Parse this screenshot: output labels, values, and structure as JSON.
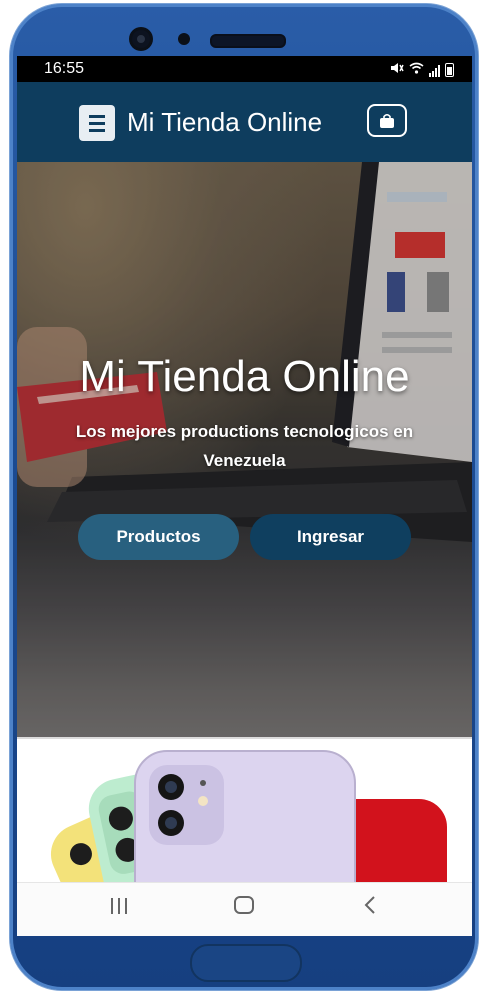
{
  "status_bar": {
    "time": "16:55",
    "icons": [
      "mute-icon",
      "wifi-icon",
      "signal-icon",
      "battery-icon"
    ]
  },
  "app_bar": {
    "title": "Mi Tienda Online",
    "menu_icon": "hamburger-menu-icon",
    "cart_icon": "shopping-bag-icon",
    "background": "#0e3d5e"
  },
  "hero": {
    "title": "Mi Tienda Online",
    "subtitle": "Los mejores productions tecnologicos en Venezuela",
    "buttons": [
      {
        "label": "Productos",
        "color": "#28607f"
      },
      {
        "label": "Ingresar",
        "color": "#0f3f5f"
      }
    ]
  },
  "android_nav": {
    "recent_icon": "recent-apps-icon",
    "home_icon": "home-icon",
    "back_icon": "back-icon"
  },
  "colors": {
    "phone_frame": "#1b4b92",
    "accent": "#0e3d5e"
  }
}
